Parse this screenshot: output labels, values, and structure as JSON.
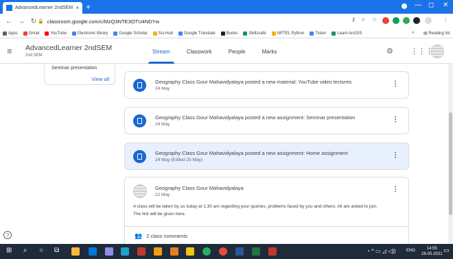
{
  "browser": {
    "tab_title": "AdvancedLearner 2ndSEM 2nd S",
    "tab_close": "×",
    "new_tab": "+",
    "url": "classroom.google.com/c/MzQ3NTE3OTU4NDYw",
    "window_controls": [
      "—",
      "◻",
      "✕"
    ],
    "accent_color": "#1a73e8"
  },
  "bookmarks": {
    "items": [
      {
        "label": "Apps",
        "icon_color": "#5f6368"
      },
      {
        "label": "Gmail",
        "icon_color": "#ea4335"
      },
      {
        "label": "YouTube",
        "icon_color": "#ff0000"
      },
      {
        "label": "Electronic library",
        "icon_color": "#4285f4"
      },
      {
        "label": "Google Scholar",
        "icon_color": "#4285f4"
      },
      {
        "label": "Sci-Hub",
        "icon_color": "#f4b400"
      },
      {
        "label": "Google Translate",
        "icon_color": "#4285f4"
      },
      {
        "label": "Books",
        "icon_color": "#202124"
      },
      {
        "label": "Skillzcafe",
        "icon_color": "#0f9d58"
      },
      {
        "label": "NPTEL Python",
        "icon_color": "#f4b400"
      },
      {
        "label": "Ticker",
        "icon_color": "#4285f4"
      },
      {
        "label": "Learn ArcGIS",
        "icon_color": "#0f9d58"
      }
    ],
    "more": "»",
    "reading_list": "Reading list"
  },
  "classroom": {
    "title": "AdvancedLearner 2ndSEM",
    "subtitle": "2nd SEM",
    "tabs": [
      {
        "label": "Stream",
        "active": true
      },
      {
        "label": "Classwork",
        "active": false
      },
      {
        "label": "People",
        "active": false
      },
      {
        "label": "Marks",
        "active": false
      }
    ],
    "brand_color": "#1967d2"
  },
  "upcoming": {
    "item": "Seminar presentation",
    "view_all": "View all"
  },
  "posts": [
    {
      "title": "Geography Class Gour Mahavidyalaya posted a new material: YouTube video lectures",
      "date": "24 May",
      "highlight": false
    },
    {
      "title": "Geography Class Gour Mahavidyalaya posted a new assignment: Seminar presentation",
      "date": "24 May",
      "highlight": false
    },
    {
      "title": "Geography Class Gour Mahavidyalaya posted a new assignment: Home assignment",
      "date": "24 May (Edited 25 May)",
      "highlight": true
    }
  ],
  "announcement": {
    "author": "Geography Class Gour Mahavidyalaya",
    "date": "22 May",
    "body_line1": "A class will be taken by us today at 1.30 am regarding your queries, problems faced by you and others. All are asked to join.",
    "body_line2": "The link will be given here.",
    "comments": "2 class comments"
  },
  "help": "?",
  "taskbar": {
    "lang": "ENG",
    "time": "14:55",
    "date": "28-05-2021"
  }
}
